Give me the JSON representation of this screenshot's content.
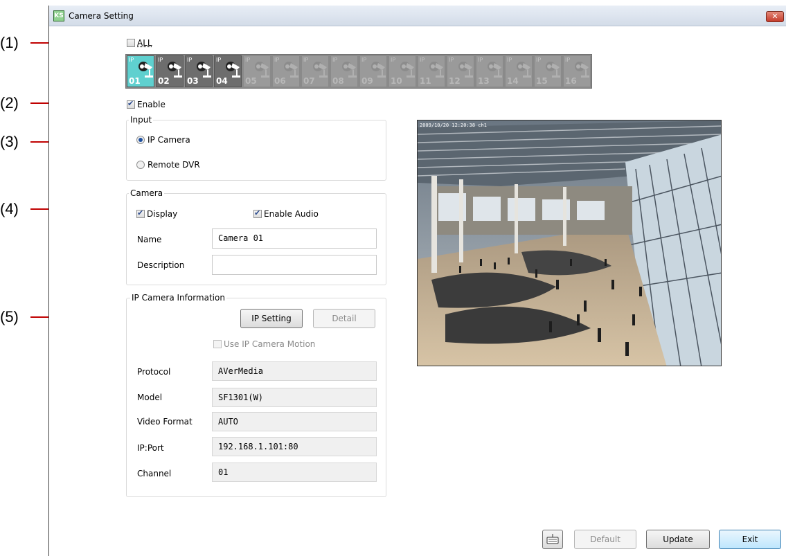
{
  "callouts": [
    "(1)",
    "(2)",
    "(3)",
    "(4)",
    "(5)"
  ],
  "window": {
    "title": "Camera Setting",
    "icon_text": "KS",
    "close_icon": "close-icon"
  },
  "all_checkbox": {
    "label": "ALL",
    "checked": false
  },
  "cameras": [
    {
      "num": "01",
      "tag": "IP",
      "active": true,
      "enabled": true
    },
    {
      "num": "02",
      "tag": "IP",
      "active": false,
      "enabled": true
    },
    {
      "num": "03",
      "tag": "IP",
      "active": false,
      "enabled": true
    },
    {
      "num": "04",
      "tag": "IP",
      "active": false,
      "enabled": true
    },
    {
      "num": "05",
      "tag": "IP",
      "active": false,
      "enabled": false
    },
    {
      "num": "06",
      "tag": "IP",
      "active": false,
      "enabled": false
    },
    {
      "num": "07",
      "tag": "IP",
      "active": false,
      "enabled": false
    },
    {
      "num": "08",
      "tag": "IP",
      "active": false,
      "enabled": false
    },
    {
      "num": "09",
      "tag": "IP",
      "active": false,
      "enabled": false
    },
    {
      "num": "10",
      "tag": "IP",
      "active": false,
      "enabled": false
    },
    {
      "num": "11",
      "tag": "IP",
      "active": false,
      "enabled": false
    },
    {
      "num": "12",
      "tag": "IP",
      "active": false,
      "enabled": false
    },
    {
      "num": "13",
      "tag": "IP",
      "active": false,
      "enabled": false
    },
    {
      "num": "14",
      "tag": "IP",
      "active": false,
      "enabled": false
    },
    {
      "num": "15",
      "tag": "IP",
      "active": false,
      "enabled": false
    },
    {
      "num": "16",
      "tag": "IP",
      "active": false,
      "enabled": false
    }
  ],
  "enable": {
    "label": "Enable",
    "checked": true
  },
  "input": {
    "title": "Input",
    "ip_camera": "IP Camera",
    "remote_dvr": "Remote DVR",
    "selected": "IP Camera"
  },
  "camera": {
    "title": "Camera",
    "display": "Display",
    "enable_audio": "Enable Audio",
    "name_label": "Name",
    "name_value": "Camera 01",
    "description_label": "Description",
    "description_value": ""
  },
  "ipinfo": {
    "title": "IP Camera Information",
    "ip_setting": "IP Setting",
    "detail": "Detail",
    "use_motion": "Use IP Camera Motion",
    "protocol_label": "Protocol",
    "protocol_value": "AVerMedia",
    "model_label": "Model",
    "model_value": "SF1301(W)",
    "video_format_label": "Video Format",
    "video_format_value": "AUTO",
    "ipport_label": "IP:Port",
    "ipport_value": "192.168.1.101:80",
    "channel_label": "Channel",
    "channel_value": "01"
  },
  "preview": {
    "timestamp": "2009/10/20 12:20:38 ch1"
  },
  "footer": {
    "keyboard_icon": "keyboard-icon",
    "default": "Default",
    "update": "Update",
    "exit": "Exit"
  },
  "colors": {
    "callout_line": "#c00000",
    "active_tile": "#5fd0cf",
    "accent": "#1e4f9e"
  }
}
